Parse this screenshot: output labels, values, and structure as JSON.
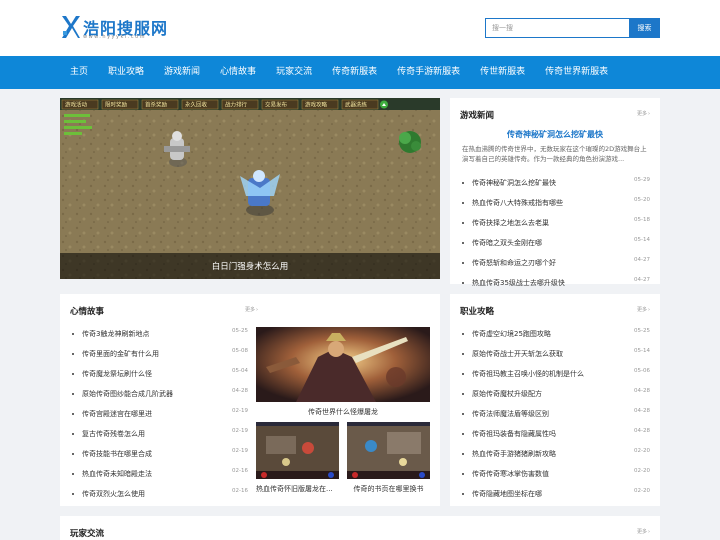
{
  "header": {
    "logo_text": "浩阳搜服网",
    "logo_sub": "www.hyyyki.com",
    "search_placeholder": "搜一搜",
    "search_button": "搜索",
    "accent": "#1d77c9"
  },
  "nav": {
    "color": "#0e87d8",
    "items": [
      "主页",
      "职业攻略",
      "游戏新闻",
      "心情故事",
      "玩家交流",
      "传奇新服表",
      "传奇手游新服表",
      "传世新服表",
      "传奇世界新服表"
    ]
  },
  "banner": {
    "caption": "白日门强身术怎么用",
    "menu": [
      "游戏活动",
      "限时奖励",
      "首杀奖励",
      "永久回收",
      "战力排行",
      "交易发布",
      "游戏攻略",
      "武器洗练"
    ]
  },
  "game_news": {
    "title": "游戏新闻",
    "more": "更多",
    "featured_title": "传奇神秘矿洞怎么挖矿最快",
    "featured_desc": "在热血沸腾的传奇世界中，无数玩家在这个璀璨的2D游戏舞台上演写着自己的英雄传奇。作为一款经典的角色扮演游戏...",
    "items": [
      {
        "title": "传奇神秘矿洞怎么挖矿最快",
        "date": "05-29"
      },
      {
        "title": "热血传奇八大特殊戒指有哪些",
        "date": "05-20"
      },
      {
        "title": "传奇抉择之地怎么去老巢",
        "date": "05-18"
      },
      {
        "title": "传奇暗之双头金刚在哪",
        "date": "05-14"
      },
      {
        "title": "传奇怒斩和命运之刃哪个好",
        "date": "04-27"
      },
      {
        "title": "热血传奇35级战士去哪升级快",
        "date": "04-27"
      }
    ]
  },
  "stories": {
    "title": "心情故事",
    "more": "更多",
    "items": [
      {
        "title": "传奇3触龙神刷新地点",
        "date": "05-25"
      },
      {
        "title": "传奇里面的金矿有什么用",
        "date": "05-08"
      },
      {
        "title": "传奇魔龙祭坛刷什么怪",
        "date": "05-04"
      },
      {
        "title": "原始传奇图纱能合成几阶武器",
        "date": "04-28"
      },
      {
        "title": "传奇宫殿迷宫在哪里进",
        "date": "02-19"
      },
      {
        "title": "复古传奇残卷怎么用",
        "date": "02-19"
      },
      {
        "title": "传奇技能书在哪里合成",
        "date": "02-19"
      },
      {
        "title": "热血传奇未知暗殿走法",
        "date": "02-16"
      },
      {
        "title": "传奇双烈火怎么使用",
        "date": "02-16"
      }
    ],
    "pic_main_caption": "传奇世界什么怪爆屠龙",
    "pic_a_caption": "热血传奇怀旧版屠龙在...",
    "pic_b_caption": "传奇的书页在哪里换书"
  },
  "strategy": {
    "title": "职业攻略",
    "more": "更多",
    "items": [
      {
        "title": "传奇虚空幻境25跑图攻略",
        "date": "05-25"
      },
      {
        "title": "原始传奇战士开天斩怎么获取",
        "date": "05-14"
      },
      {
        "title": "传奇祖玛教主召唤小怪的机制是什么",
        "date": "05-06"
      },
      {
        "title": "原始传奇魔杖升级配方",
        "date": "04-28"
      },
      {
        "title": "传奇法师魔法盾等级区别",
        "date": "04-28"
      },
      {
        "title": "传奇祖玛装备有隐藏属性吗",
        "date": "04-28"
      },
      {
        "title": "热血传奇手游猪猪刷新攻略",
        "date": "02-20"
      },
      {
        "title": "传奇传奇寒冰掌伤害数值",
        "date": "02-20"
      },
      {
        "title": "传奇隐藏地图坐标在哪",
        "date": "02-20"
      }
    ]
  },
  "players": {
    "title": "玩家交流",
    "more": "更多"
  }
}
